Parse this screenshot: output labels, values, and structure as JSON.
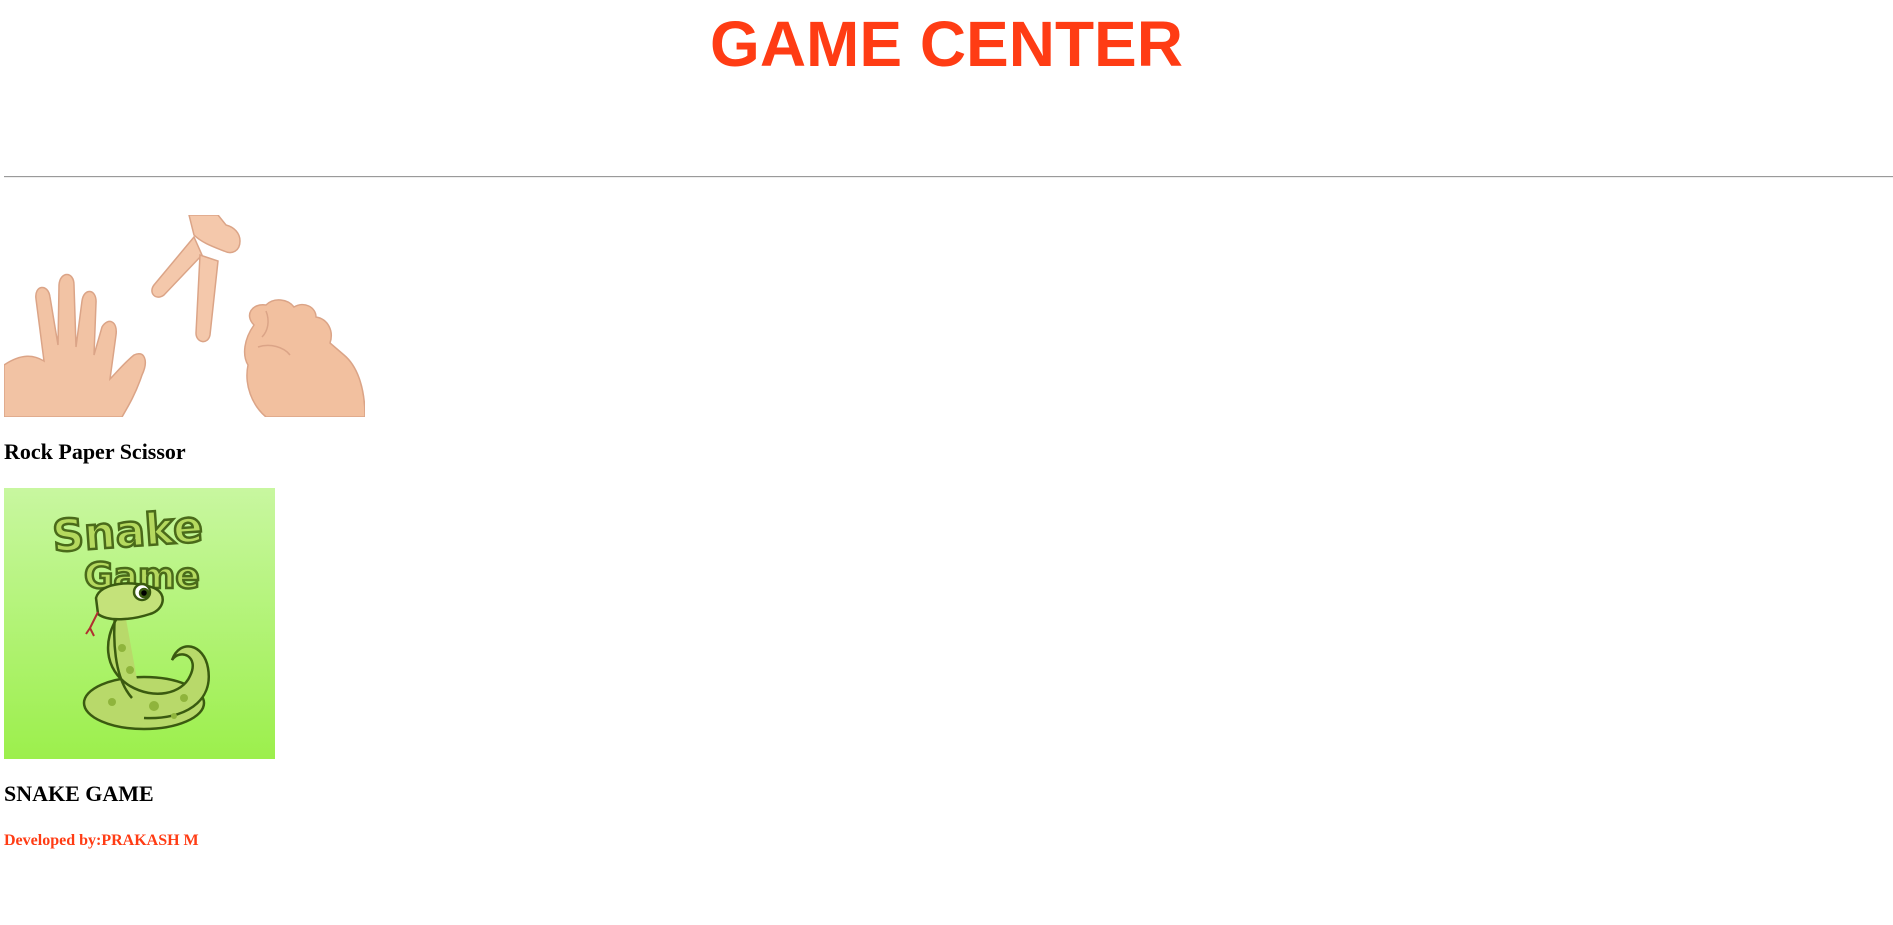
{
  "header": {
    "title": "GAME CENTER",
    "title_color": "#ff3c14"
  },
  "games": [
    {
      "label": "Rock Paper Scissor",
      "image": "rock-paper-scissor-hands"
    },
    {
      "label": "SNAKE GAME",
      "image": "snake-game-cartoon",
      "image_text": [
        "Snake",
        "Game"
      ],
      "image_colors": {
        "bg_top": "#c8f7a0",
        "bg_bottom": "#9cef4c",
        "snake": "#b8d96a"
      }
    }
  ],
  "footer": {
    "credit": "Developed by:PRAKASH M",
    "credit_color": "#ff3c14"
  }
}
